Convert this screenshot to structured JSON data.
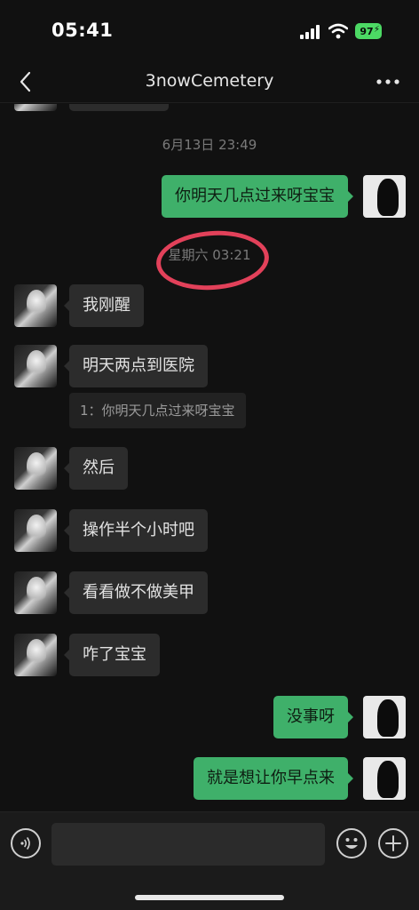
{
  "status_bar": {
    "time": "05:41",
    "battery": "97",
    "icons": [
      "signal-icon",
      "wifi-icon",
      "battery-icon"
    ]
  },
  "nav": {
    "title": "3nowCemetery",
    "back_icon": "chevron-left-icon",
    "more_icon": "more-dots-icon"
  },
  "chat": {
    "timestamp_1": "6月13日 23:49",
    "timestamp_2": "星期六 03:21",
    "messages": [
      {
        "side": "out",
        "text": "你明天几点过来呀宝宝"
      },
      {
        "side": "in",
        "text": "我刚醒"
      },
      {
        "side": "in",
        "text": "明天两点到医院",
        "quote": "1：你明天几点过来呀宝宝"
      },
      {
        "side": "in",
        "text": "然后"
      },
      {
        "side": "in",
        "text": "操作半个小时吧"
      },
      {
        "side": "in",
        "text": "看看做不做美甲"
      },
      {
        "side": "in",
        "text": "咋了宝宝"
      },
      {
        "side": "out",
        "text": "没事呀"
      },
      {
        "side": "out",
        "text": "就是想让你早点来"
      }
    ]
  },
  "input_bar": {
    "placeholder": "",
    "icons": [
      "voice-icon",
      "emoji-icon",
      "plus-icon"
    ]
  },
  "colors": {
    "background": "#111111",
    "bubble_in": "#2c2c2c",
    "bubble_out": "#3fb06a",
    "highlight_circle": "#e2415a",
    "battery": "#4cd964"
  }
}
